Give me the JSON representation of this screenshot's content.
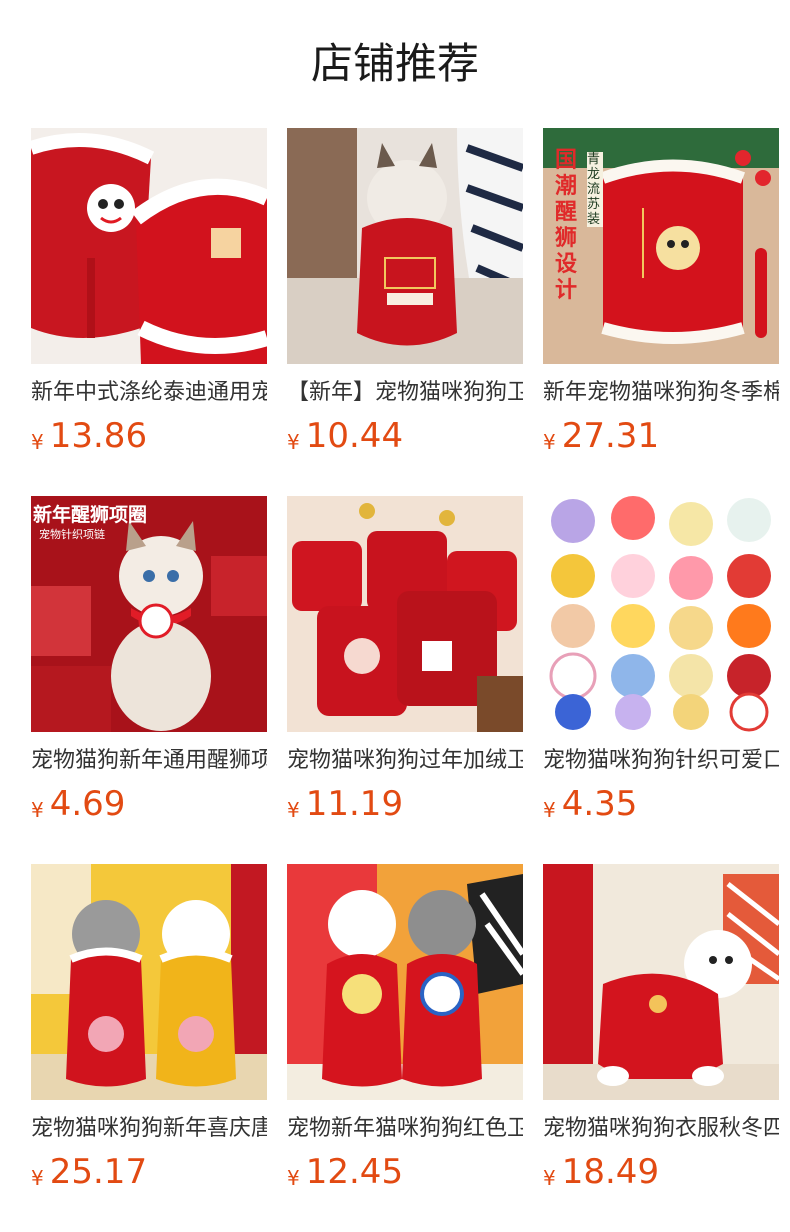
{
  "section_title": "店铺推荐",
  "products": [
    {
      "name": "新年中式涤纶泰迪通用宠物衣服",
      "currency": "¥",
      "price": "13.86",
      "image": "red-knit-lion-vest"
    },
    {
      "name": "【新年】宠物猫咪狗狗卫衣",
      "currency": "¥",
      "price": "10.44",
      "image": "cat-red-new-year-sweater"
    },
    {
      "name": "新年宠物猫咪狗狗冬季棉衣",
      "currency": "¥",
      "price": "27.31",
      "image": "red-lion-tang-suit"
    },
    {
      "name": "宠物猫狗新年通用醒狮项圈",
      "currency": "¥",
      "price": "4.69",
      "image": "cat-lion-knit-collar"
    },
    {
      "name": "宠物猫咪狗狗过年加绒卫衣",
      "currency": "¥",
      "price": "11.19",
      "image": "red-sweaters-flatlay"
    },
    {
      "name": "宠物猫咪狗狗针织可爱口水巾",
      "currency": "¥",
      "price": "4.35",
      "image": "assorted-bibs"
    },
    {
      "name": "宠物猫咪狗狗新年喜庆唐装",
      "currency": "¥",
      "price": "25.17",
      "image": "dogs-tang-jackets"
    },
    {
      "name": "宠物新年猫咪狗狗红色卫衣",
      "currency": "¥",
      "price": "12.45",
      "image": "dogs-red-lion-hoodies"
    },
    {
      "name": "宠物猫咪狗狗衣服秋冬四脚衣",
      "currency": "¥",
      "price": "18.49",
      "image": "dog-red-jumpsuit"
    }
  ],
  "banner_text": {
    "p3_vertical": "国潮醒狮设计",
    "p3_tag": "青龙流苏装",
    "p4_title": "新年醒狮项圈",
    "p4_sub": "宠物针织项链"
  }
}
